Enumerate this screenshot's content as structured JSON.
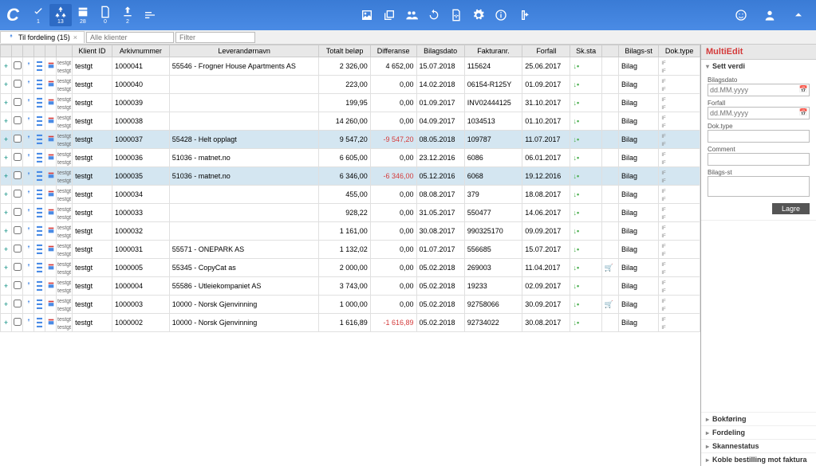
{
  "app_logo": "C",
  "toolbar": {
    "counts": [
      "1",
      "13",
      "28",
      "0",
      "2"
    ]
  },
  "filter": {
    "tab_label": "Til fordeling (15)",
    "clients_placeholder": "Alle klienter",
    "filter_placeholder": "Filter"
  },
  "columns": [
    "",
    "",
    "",
    "",
    "",
    "",
    "Klient ID",
    "Arkivnummer",
    "Leverandørnavn",
    "Totalt beløp",
    "Differanse",
    "Bilagsdato",
    "Fakturanr.",
    "Forfall",
    "Sk.sta",
    "",
    "Bilags-st",
    "Dok.type"
  ],
  "rows": [
    {
      "klient": "testgt",
      "arkiv": "1000041",
      "lev": "55546 - Frogner House Apartments AS",
      "total": "2 326,00",
      "diff": "4 652,00",
      "diff_neg": false,
      "bilag": "15.07.2018",
      "fakt": "115624",
      "forfall": "25.06.2017",
      "bstat": "Bilag",
      "carticon": false
    },
    {
      "klient": "testgt",
      "arkiv": "1000040",
      "lev": "",
      "total": "223,00",
      "diff": "0,00",
      "diff_neg": false,
      "bilag": "14.02.2018",
      "fakt": "06154-R125Y",
      "forfall": "01.09.2017",
      "bstat": "Bilag",
      "carticon": false
    },
    {
      "klient": "testgt",
      "arkiv": "1000039",
      "lev": "",
      "total": "199,95",
      "diff": "0,00",
      "diff_neg": false,
      "bilag": "01.09.2017",
      "fakt": "INV02444125",
      "forfall": "31.10.2017",
      "bstat": "Bilag",
      "carticon": false
    },
    {
      "klient": "testgt",
      "arkiv": "1000038",
      "lev": "",
      "total": "14 260,00",
      "diff": "0,00",
      "diff_neg": false,
      "bilag": "04.09.2017",
      "fakt": "1034513",
      "forfall": "01.10.2017",
      "bstat": "Bilag",
      "carticon": false
    },
    {
      "klient": "testgt",
      "arkiv": "1000037",
      "lev": "55428 - Helt opplagt",
      "total": "9 547,20",
      "diff": "-9 547,20",
      "diff_neg": true,
      "bilag": "08.05.2018",
      "fakt": "109787",
      "forfall": "11.07.2017",
      "bstat": "Bilag",
      "carticon": false,
      "sel": true
    },
    {
      "klient": "testgt",
      "arkiv": "1000036",
      "lev": "51036 - matnet.no",
      "total": "6 605,00",
      "diff": "0,00",
      "diff_neg": false,
      "bilag": "23.12.2016",
      "fakt": "6086",
      "forfall": "06.01.2017",
      "bstat": "Bilag",
      "carticon": false
    },
    {
      "klient": "testgt",
      "arkiv": "1000035",
      "lev": "51036 - matnet.no",
      "total": "6 346,00",
      "diff": "-6 346,00",
      "diff_neg": true,
      "bilag": "05.12.2016",
      "fakt": "6068",
      "forfall": "19.12.2016",
      "bstat": "Bilag",
      "carticon": false,
      "sel": true
    },
    {
      "klient": "testgt",
      "arkiv": "1000034",
      "lev": "",
      "total": "455,00",
      "diff": "0,00",
      "diff_neg": false,
      "bilag": "08.08.2017",
      "fakt": "379",
      "forfall": "18.08.2017",
      "bstat": "Bilag",
      "carticon": false
    },
    {
      "klient": "testgt",
      "arkiv": "1000033",
      "lev": "",
      "total": "928,22",
      "diff": "0,00",
      "diff_neg": false,
      "bilag": "31.05.2017",
      "fakt": "550477",
      "forfall": "14.06.2017",
      "bstat": "Bilag",
      "carticon": false
    },
    {
      "klient": "testgt",
      "arkiv": "1000032",
      "lev": "",
      "total": "1 161,00",
      "diff": "0,00",
      "diff_neg": false,
      "bilag": "30.08.2017",
      "fakt": "990325170",
      "forfall": "09.09.2017",
      "bstat": "Bilag",
      "carticon": false
    },
    {
      "klient": "testgt",
      "arkiv": "1000031",
      "lev": "55571 - ONEPARK AS",
      "total": "1 132,02",
      "diff": "0,00",
      "diff_neg": false,
      "bilag": "01.07.2017",
      "fakt": "556685",
      "forfall": "15.07.2017",
      "bstat": "Bilag",
      "carticon": false
    },
    {
      "klient": "testgt",
      "arkiv": "1000005",
      "lev": "55345 - CopyCat as",
      "total": "2 000,00",
      "diff": "0,00",
      "diff_neg": false,
      "bilag": "05.02.2018",
      "fakt": "269003",
      "forfall": "11.04.2017",
      "bstat": "Bilag",
      "carticon": true
    },
    {
      "klient": "testgt",
      "arkiv": "1000004",
      "lev": "55586 - Utleiekompaniet AS",
      "total": "3 743,00",
      "diff": "0,00",
      "diff_neg": false,
      "bilag": "05.02.2018",
      "fakt": "19233",
      "forfall": "02.09.2017",
      "bstat": "Bilag",
      "carticon": false
    },
    {
      "klient": "testgt",
      "arkiv": "1000003",
      "lev": "10000 - Norsk Gjenvinning",
      "total": "1 000,00",
      "diff": "0,00",
      "diff_neg": false,
      "bilag": "05.02.2018",
      "fakt": "92758066",
      "forfall": "30.09.2017",
      "bstat": "Bilag",
      "carticon": true
    },
    {
      "klient": "testgt",
      "arkiv": "1000002",
      "lev": "10000 - Norsk Gjenvinning",
      "total": "1 616,89",
      "diff": "-1 616,89",
      "diff_neg": true,
      "bilag": "05.02.2018",
      "fakt": "92734022",
      "forfall": "30.08.2017",
      "bstat": "Bilag",
      "carticon": false
    }
  ],
  "rightpanel": {
    "title": "MultiEdit",
    "set_value": "Sett verdi",
    "bilagsdato": "Bilagsdato",
    "bilagsdato_ph": "dd.MM.yyyy",
    "forfall": "Forfall",
    "forfall_ph": "dd.MM.yyyy",
    "doktype": "Dok.type",
    "comment": "Comment",
    "bilagsst": "Bilags-st",
    "save": "Lagre",
    "bokforing": "Bokføring",
    "fordeling": "Fordeling",
    "skannestatus": "Skannestatus",
    "koble": "Koble bestilling mot faktura"
  }
}
